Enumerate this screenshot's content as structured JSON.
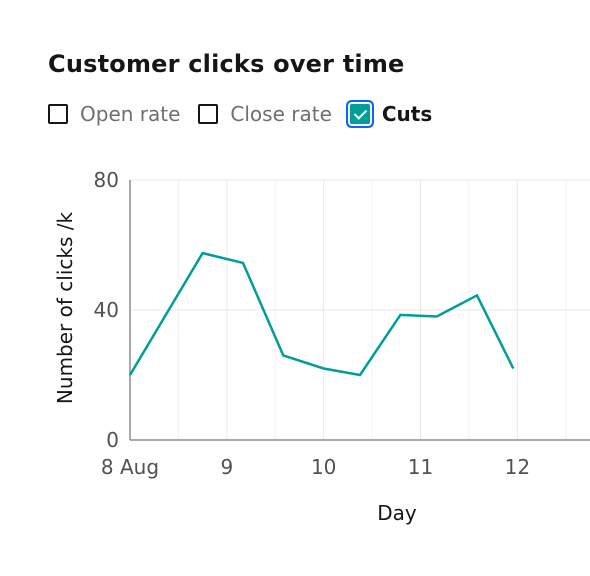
{
  "title": "Customer clicks over time",
  "legend": [
    {
      "label": "Open rate",
      "checked": false
    },
    {
      "label": "Close rate",
      "checked": false
    },
    {
      "label": "Cuts",
      "checked": true
    }
  ],
  "colors": {
    "series": "#009d9a",
    "axis": "#8d8d8d",
    "grid": "#e8e8e8",
    "focus": "#0f62fe"
  },
  "chart_data": {
    "type": "line",
    "title": "Customer clicks over time",
    "xlabel": "Day",
    "ylabel": "Number of clicks /k",
    "x_ticks": [
      "8 Aug",
      "9",
      "10",
      "11",
      "12"
    ],
    "y_ticks": [
      "0",
      "40",
      "80"
    ],
    "ylim": [
      0,
      80
    ],
    "xlim": [
      "2019-08-08T00:00",
      "2019-08-12T18:00"
    ],
    "grid": true,
    "series": [
      {
        "name": "Cuts",
        "points": [
          {
            "x": "2019-08-08T00:00",
            "y": 20
          },
          {
            "x": "2019-08-08T18:00",
            "y": 57.5
          },
          {
            "x": "2019-08-09T04:00",
            "y": 54.5
          },
          {
            "x": "2019-08-09T14:00",
            "y": 26
          },
          {
            "x": "2019-08-10T00:00",
            "y": 22
          },
          {
            "x": "2019-08-10T09:00",
            "y": 20
          },
          {
            "x": "2019-08-10T19:00",
            "y": 38.5
          },
          {
            "x": "2019-08-11T04:00",
            "y": 38
          },
          {
            "x": "2019-08-11T14:00",
            "y": 44.5
          },
          {
            "x": "2019-08-11T23:00",
            "y": 22
          }
        ]
      }
    ]
  }
}
